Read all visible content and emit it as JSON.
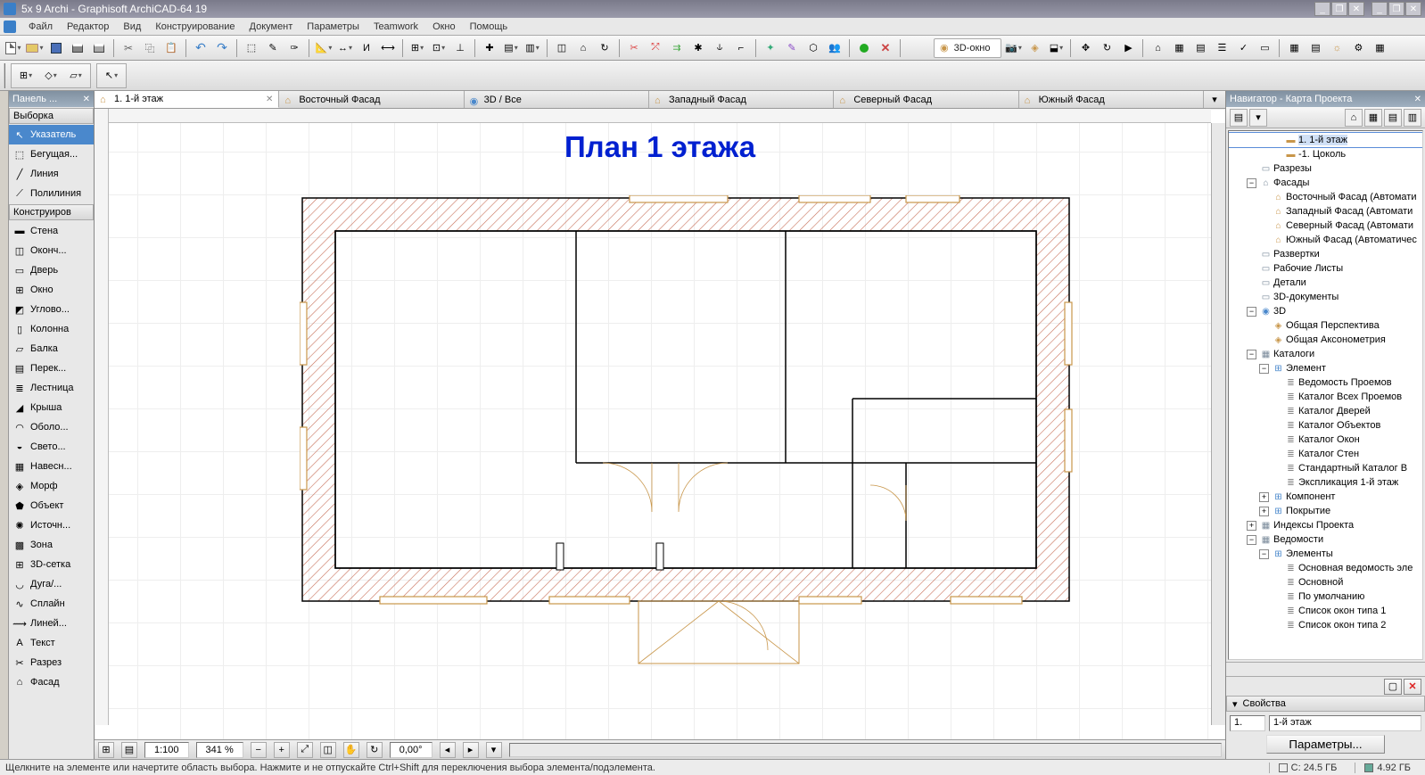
{
  "window": {
    "title": "5x 9 Archi - Graphisoft ArchiCAD-64 19"
  },
  "menu": [
    "Файл",
    "Редактор",
    "Вид",
    "Конструирование",
    "Документ",
    "Параметры",
    "Teamwork",
    "Окно",
    "Помощь"
  ],
  "toolbar1": {
    "window_label": "3D-окно"
  },
  "toolpanel": {
    "title": "Панель ...",
    "section_selection": "Выборка",
    "section_construct": "Конструиров",
    "selection_items": [
      {
        "icon": "cursor",
        "label": "Указатель"
      },
      {
        "icon": "marquee",
        "label": "Бегущая..."
      },
      {
        "icon": "line",
        "label": "Линия"
      },
      {
        "icon": "polyline",
        "label": "Полилиния"
      }
    ],
    "construct_items": [
      {
        "icon": "wall",
        "label": "Стена"
      },
      {
        "icon": "column-end",
        "label": "Оконч..."
      },
      {
        "icon": "beam",
        "label": "Дверь"
      },
      {
        "icon": "window",
        "label": "Окно"
      },
      {
        "icon": "corner",
        "label": "Углово..."
      },
      {
        "icon": "column",
        "label": "Колонна"
      },
      {
        "icon": "slab",
        "label": "Балка"
      },
      {
        "icon": "slab2",
        "label": "Перек..."
      },
      {
        "icon": "stair",
        "label": "Лестница"
      },
      {
        "icon": "roof",
        "label": "Крыша"
      },
      {
        "icon": "shell",
        "label": "Оболо..."
      },
      {
        "icon": "skylight",
        "label": "Свето..."
      },
      {
        "icon": "curtain",
        "label": "Навесн..."
      },
      {
        "icon": "morph",
        "label": "Морф"
      },
      {
        "icon": "object",
        "label": "Объект"
      },
      {
        "icon": "lamp",
        "label": "Источн..."
      },
      {
        "icon": "zone",
        "label": "Зона"
      },
      {
        "icon": "mesh",
        "label": "3D-сетка"
      },
      {
        "icon": "arc",
        "label": "Дуга/..."
      },
      {
        "icon": "spline",
        "label": "Сплайн"
      },
      {
        "icon": "linear",
        "label": "Линей..."
      },
      {
        "icon": "text",
        "label": "Текст"
      },
      {
        "icon": "section",
        "label": "Разрез"
      },
      {
        "icon": "elevation",
        "label": "Фасад"
      }
    ]
  },
  "tabs": [
    {
      "icon": "folder",
      "label": "1. 1-й этаж",
      "active": true,
      "closable": true
    },
    {
      "icon": "facade",
      "label": "Восточный Фасад"
    },
    {
      "icon": "cube",
      "label": "3D / Все"
    },
    {
      "icon": "facade",
      "label": "Западный Фасад"
    },
    {
      "icon": "facade",
      "label": "Северный Фасад"
    },
    {
      "icon": "facade",
      "label": "Южный Фасад"
    }
  ],
  "view_title": "План 1 этажа",
  "canvas_status": {
    "scale": "1:100",
    "zoom": "341 %",
    "angle": "0,00°"
  },
  "navigator": {
    "title": "Навигатор - Карта Проекта",
    "props_header": "Свойства",
    "field1": "1.",
    "field2": "1-й этаж",
    "params_btn": "Параметры...",
    "tree": [
      {
        "d": 3,
        "i": "folder",
        "l": "1. 1-й этаж",
        "sel": true
      },
      {
        "d": 3,
        "i": "folder",
        "l": "-1. Цоколь"
      },
      {
        "d": 1,
        "i": "page",
        "l": "Разрезы"
      },
      {
        "d": 1,
        "i": "camera",
        "l": "Фасады",
        "e": "-"
      },
      {
        "d": 2,
        "i": "facade",
        "l": "Восточный Фасад (Автомати"
      },
      {
        "d": 2,
        "i": "facade",
        "l": "Западный Фасад (Автомати"
      },
      {
        "d": 2,
        "i": "facade",
        "l": "Северный Фасад (Автомати"
      },
      {
        "d": 2,
        "i": "facade",
        "l": "Южный Фасад (Автоматичес"
      },
      {
        "d": 1,
        "i": "page",
        "l": "Развертки"
      },
      {
        "d": 1,
        "i": "page",
        "l": "Рабочие Листы"
      },
      {
        "d": 1,
        "i": "page",
        "l": "Детали"
      },
      {
        "d": 1,
        "i": "page",
        "l": "3D-документы"
      },
      {
        "d": 1,
        "i": "cube",
        "l": "3D",
        "e": "-"
      },
      {
        "d": 2,
        "i": "persp",
        "l": "Общая Перспектива"
      },
      {
        "d": 2,
        "i": "persp",
        "l": "Общая Аксонометрия"
      },
      {
        "d": 1,
        "i": "book",
        "l": "Каталоги",
        "e": "-"
      },
      {
        "d": 2,
        "i": "grid",
        "l": "Элемент",
        "e": "-"
      },
      {
        "d": 3,
        "i": "list",
        "l": "Ведомость Проемов"
      },
      {
        "d": 3,
        "i": "list",
        "l": "Каталог Всех Проемов"
      },
      {
        "d": 3,
        "i": "list",
        "l": "Каталог Дверей"
      },
      {
        "d": 3,
        "i": "list",
        "l": "Каталог Объектов"
      },
      {
        "d": 3,
        "i": "list",
        "l": "Каталог Окон"
      },
      {
        "d": 3,
        "i": "list",
        "l": "Каталог Стен"
      },
      {
        "d": 3,
        "i": "list",
        "l": "Стандартный Каталог В"
      },
      {
        "d": 3,
        "i": "list",
        "l": "Экспликация 1-й этаж"
      },
      {
        "d": 2,
        "i": "grid",
        "l": "Компонент",
        "e": "+"
      },
      {
        "d": 2,
        "i": "grid",
        "l": "Покрытие",
        "e": "+"
      },
      {
        "d": 1,
        "i": "book",
        "l": "Индексы Проекта",
        "e": "+"
      },
      {
        "d": 1,
        "i": "book",
        "l": "Ведомости",
        "e": "-"
      },
      {
        "d": 2,
        "i": "grid",
        "l": "Элементы",
        "e": "-"
      },
      {
        "d": 3,
        "i": "list",
        "l": "Основная ведомость эле"
      },
      {
        "d": 3,
        "i": "list",
        "l": "Основной"
      },
      {
        "d": 3,
        "i": "list",
        "l": "По умолчанию"
      },
      {
        "d": 3,
        "i": "list",
        "l": "Список окон типа 1"
      },
      {
        "d": 3,
        "i": "list",
        "l": "Список окон типа 2"
      }
    ]
  },
  "statusbar": {
    "hint": "Щелкните на элементе или начертите область выбора. Нажмите и не отпускайте Ctrl+Shift для переключения выбора элемента/подэлемента.",
    "c": "C: 24.5 ГБ",
    "mem": "4.92 ГБ"
  }
}
